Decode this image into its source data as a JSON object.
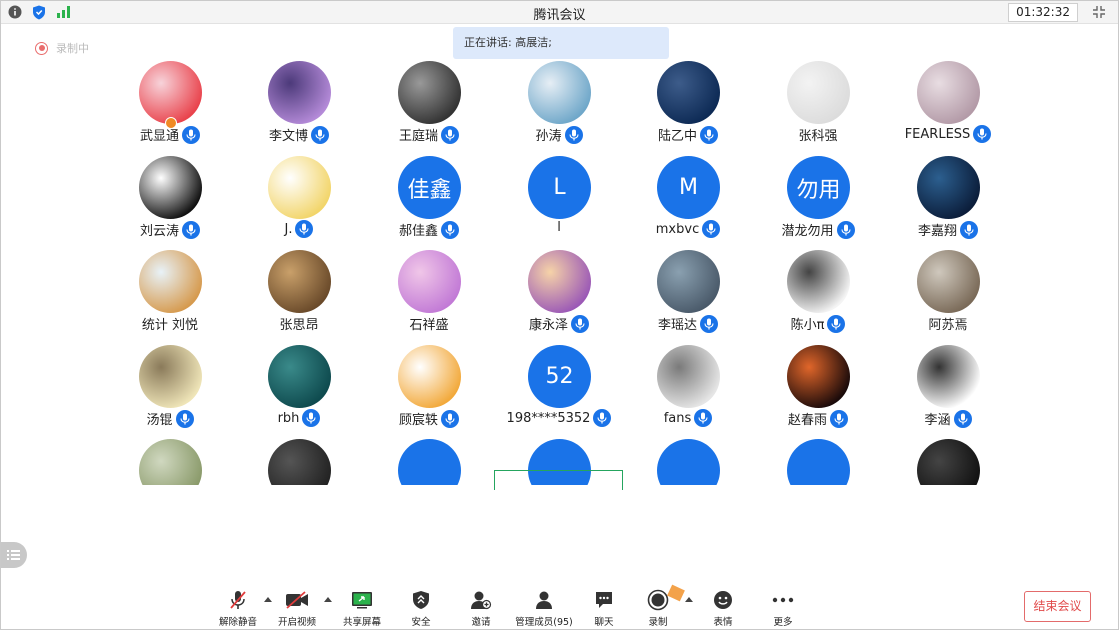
{
  "window": {
    "title": "腾讯会议",
    "timer": "01:32:32"
  },
  "status": {
    "recording_label": "录制中"
  },
  "banner": {
    "speaking": "正在讲话: 高展洁;"
  },
  "colors": {
    "accent": "#1a73e8",
    "end": "#e14a4a",
    "recording": "#e96d6d",
    "banner_bg": "#dde9fb"
  },
  "participants": [
    {
      "name": "武显通",
      "mic": true,
      "avatar_kind": "image",
      "avatar_colors": [
        "#e9434c",
        "#f7d3da"
      ],
      "host": true
    },
    {
      "name": "李文博",
      "mic": true,
      "avatar_kind": "image",
      "avatar_colors": [
        "#b48ad8",
        "#4c3a7a"
      ]
    },
    {
      "name": "王庭瑞",
      "mic": true,
      "avatar_kind": "image",
      "avatar_colors": [
        "#333333",
        "#999999"
      ]
    },
    {
      "name": "孙涛",
      "mic": true,
      "avatar_kind": "image",
      "avatar_colors": [
        "#6fa7c9",
        "#e6eef5"
      ]
    },
    {
      "name": "陆乙中",
      "mic": true,
      "avatar_kind": "image",
      "avatar_colors": [
        "#0d2a55",
        "#3d5c8a"
      ]
    },
    {
      "name": "张科强",
      "mic": false,
      "avatar_kind": "image",
      "avatar_colors": [
        "#dcdcdc",
        "#f3f3f3"
      ]
    },
    {
      "name": "FEARLESS",
      "mic": true,
      "avatar_kind": "image",
      "avatar_colors": [
        "#b39aa7",
        "#e8dde2"
      ]
    },
    {
      "name": "刘云涛",
      "mic": true,
      "avatar_kind": "image",
      "avatar_colors": [
        "#111111",
        "#ffffff"
      ]
    },
    {
      "name": "J.",
      "mic": true,
      "avatar_kind": "image",
      "avatar_colors": [
        "#f2d56a",
        "#ffffff"
      ]
    },
    {
      "name": "郝佳鑫",
      "mic": true,
      "avatar_kind": "text",
      "avatar_text": "佳鑫",
      "avatar_colors": [
        "#1a73e8"
      ]
    },
    {
      "name": "l",
      "mic": false,
      "avatar_kind": "text",
      "avatar_text": "L",
      "avatar_colors": [
        "#1a73e8"
      ]
    },
    {
      "name": "mxbvc",
      "mic": true,
      "avatar_kind": "text",
      "avatar_text": "M",
      "avatar_colors": [
        "#1a73e8"
      ]
    },
    {
      "name": "潜龙勿用",
      "mic": true,
      "avatar_kind": "text",
      "avatar_text": "勿用",
      "avatar_colors": [
        "#1a73e8"
      ]
    },
    {
      "name": "李嘉翔",
      "mic": true,
      "avatar_kind": "image",
      "avatar_colors": [
        "#0b1d3a",
        "#2c5f8f"
      ]
    },
    {
      "name": "统计 刘悦",
      "mic": false,
      "avatar_kind": "image",
      "avatar_colors": [
        "#d69a4e",
        "#e8f2f8"
      ]
    },
    {
      "name": "张思昂",
      "mic": false,
      "avatar_kind": "image",
      "avatar_colors": [
        "#6a4a2a",
        "#c9a06a"
      ]
    },
    {
      "name": "石祥盛",
      "mic": false,
      "avatar_kind": "image",
      "avatar_colors": [
        "#c27ad6",
        "#f0c6e8"
      ]
    },
    {
      "name": "康永泽",
      "mic": true,
      "avatar_kind": "image",
      "avatar_colors": [
        "#9b59b6",
        "#f6d3a8"
      ]
    },
    {
      "name": "李瑶达",
      "mic": true,
      "avatar_kind": "image",
      "avatar_colors": [
        "#4a5a6a",
        "#8aa0b0"
      ]
    },
    {
      "name": "陈小π",
      "mic": true,
      "avatar_kind": "image",
      "avatar_colors": [
        "#f4f4f4",
        "#444444"
      ]
    },
    {
      "name": "阿苏焉",
      "mic": false,
      "avatar_kind": "image",
      "avatar_colors": [
        "#7a6a58",
        "#cfc8bd"
      ]
    },
    {
      "name": "汤锟",
      "mic": true,
      "avatar_kind": "image",
      "avatar_colors": [
        "#efe5b8",
        "#8a7a5a"
      ]
    },
    {
      "name": "rbh",
      "mic": true,
      "avatar_kind": "image",
      "avatar_colors": [
        "#0e4a4e",
        "#3a8a8a"
      ]
    },
    {
      "name": "顾宸轶",
      "mic": true,
      "avatar_kind": "image",
      "avatar_colors": [
        "#f2a93b",
        "#ffffff"
      ]
    },
    {
      "name": "198****5352",
      "mic": true,
      "avatar_kind": "text",
      "avatar_text": "52",
      "avatar_colors": [
        "#1a73e8"
      ]
    },
    {
      "name": "fans",
      "mic": true,
      "avatar_kind": "image",
      "avatar_colors": [
        "#e6e6e6",
        "#7a7a7a"
      ]
    },
    {
      "name": "赵春雨",
      "mic": true,
      "avatar_kind": "image",
      "avatar_colors": [
        "#1a0a0a",
        "#e0662a"
      ]
    },
    {
      "name": "李涵",
      "mic": true,
      "avatar_kind": "image",
      "avatar_colors": [
        "#ffffff",
        "#333333"
      ]
    },
    {
      "name": "",
      "mic": false,
      "avatar_kind": "image",
      "avatar_colors": [
        "#8a9a6a",
        "#d0d8c0"
      ]
    },
    {
      "name": "",
      "mic": false,
      "avatar_kind": "image",
      "avatar_colors": [
        "#222222",
        "#555555"
      ]
    },
    {
      "name": "",
      "mic": false,
      "avatar_kind": "text",
      "avatar_text": "",
      "avatar_colors": [
        "#1a73e8"
      ]
    },
    {
      "name": "",
      "mic": false,
      "avatar_kind": "text",
      "avatar_text": "",
      "avatar_colors": [
        "#1a73e8"
      ]
    },
    {
      "name": "",
      "mic": false,
      "avatar_kind": "text",
      "avatar_text": "",
      "avatar_colors": [
        "#1a73e8"
      ]
    },
    {
      "name": "",
      "mic": false,
      "avatar_kind": "text",
      "avatar_text": "",
      "avatar_colors": [
        "#1a73e8"
      ]
    },
    {
      "name": "",
      "mic": false,
      "avatar_kind": "image",
      "avatar_colors": [
        "#111111",
        "#444444"
      ]
    }
  ],
  "toolbar": {
    "unmute": "解除静音",
    "start_video": "开启视频",
    "share_screen": "共享屏幕",
    "security": "安全",
    "invite": "邀请",
    "manage_members": "管理成员(95)",
    "chat": "聊天",
    "record": "录制",
    "reactions": "表情",
    "more": "更多",
    "end_meeting": "结束会议"
  }
}
